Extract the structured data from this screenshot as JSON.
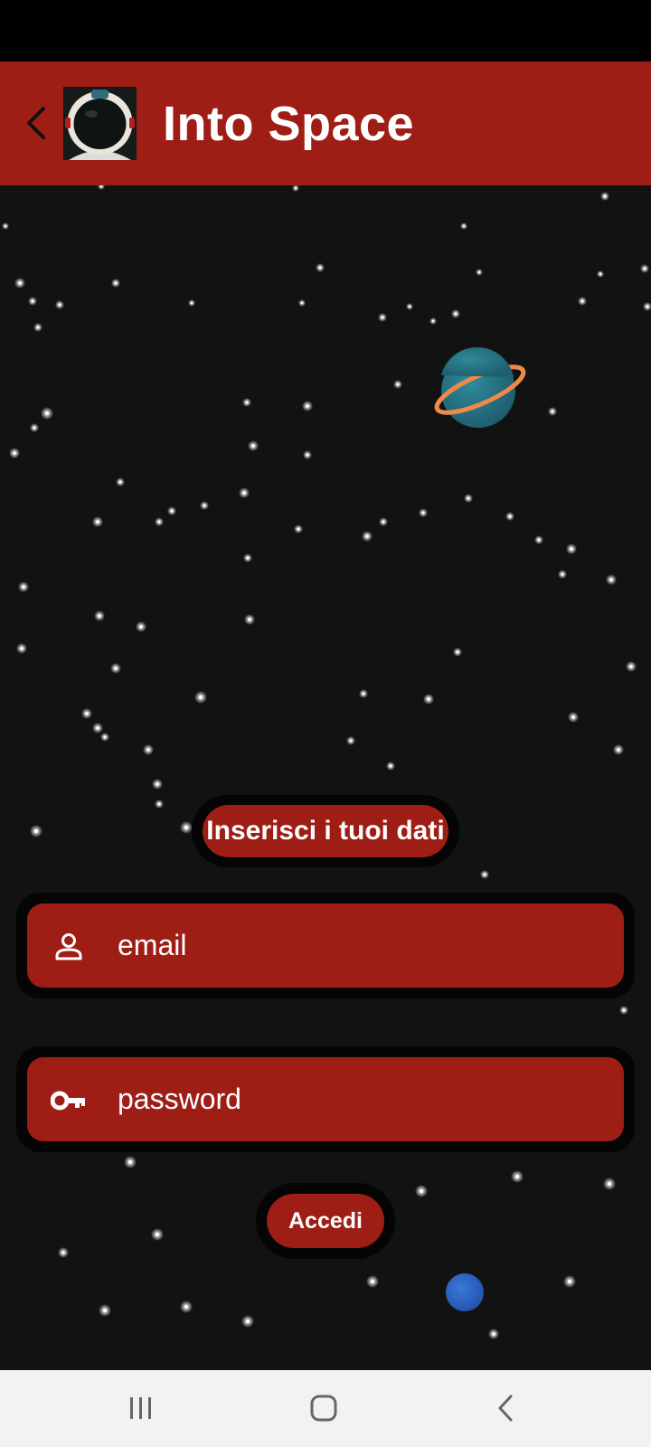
{
  "app_bar": {
    "title": "Into Space",
    "back_icon": "chevron-left-icon",
    "logo": "astronaut-helmet-logo",
    "background_color": "#9e1e16"
  },
  "scene": {
    "background_color": "#121212",
    "decorations": [
      "stars",
      "ringed-planet",
      "blue-planet"
    ]
  },
  "login": {
    "heading": "Inserisci i tuoi dati",
    "email": {
      "placeholder": "email",
      "icon": "person-icon"
    },
    "password": {
      "placeholder": "password",
      "icon": "key-icon"
    },
    "submit_label": "Accedi"
  },
  "navigation_bar": {
    "items": [
      "recent-apps-icon",
      "home-icon",
      "back-icon"
    ]
  },
  "colors": {
    "accent": "#9e1e16",
    "outline": "#050505",
    "text": "#ffffff"
  }
}
